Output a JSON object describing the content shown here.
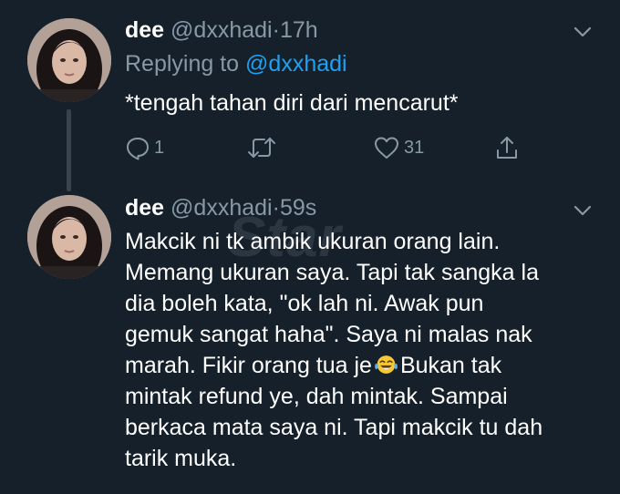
{
  "tweets": [
    {
      "name": "dee",
      "handle": "@dxxhadi",
      "separator": "·",
      "time": "17h",
      "replying_prefix": "Replying to",
      "replying_to": "@dxxhadi",
      "text": "*tengah tahan diri dari mencarut*",
      "actions": {
        "reply_count": "1",
        "retweet_count": "",
        "like_count": "31"
      }
    },
    {
      "name": "dee",
      "handle": "@dxxhadi",
      "separator": "·",
      "time": "59s",
      "lines": [
        "Makcik ni tk ambik ukuran orang lain.",
        "Memang ukuran saya. Tapi tak sangka la",
        "dia boleh kata, \"ok lah ni. Awak pun",
        "gemuk sangat haha\". Saya ni malas nak",
        "marah. Fikir orang tua je",
        "Bukan tak",
        "mintak refund ye, dah mintak. Sampai",
        "berkaca mata saya ni. Tapi makcik tu dah",
        "tarik muka."
      ],
      "emoji": "face-with-tears-of-joy"
    }
  ],
  "watermark": "Star",
  "icons": {
    "reply": "reply-icon",
    "retweet": "retweet-icon",
    "like": "heart-icon",
    "share": "share-icon",
    "menu": "chevron-down-icon"
  },
  "colors": {
    "background": "#15202b",
    "secondary_text": "#8899a6",
    "link": "#1da1f2",
    "thread_line": "#38444d"
  }
}
